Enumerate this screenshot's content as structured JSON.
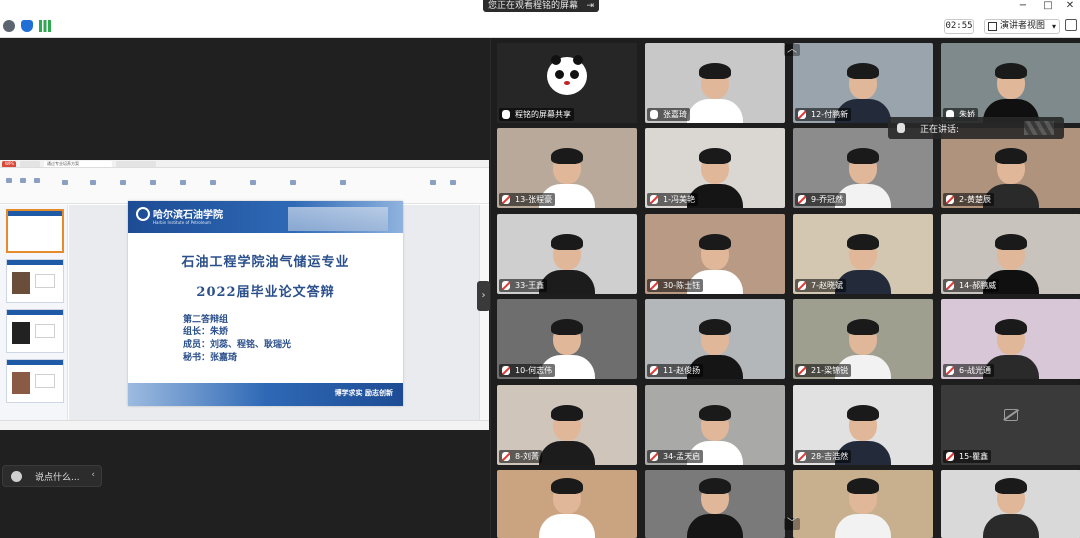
{
  "window": {
    "share_notice": "您正在观看程铭的屏幕",
    "share_notice_icon": "exit-icon",
    "controls": [
      "−",
      "□",
      "✕"
    ]
  },
  "toolbar": {
    "timer": "02:55",
    "view_label": "演讲者视图",
    "view_caret": "▾",
    "icons": [
      "info-icon",
      "shield-icon",
      "signal-icon"
    ]
  },
  "shared_screen": {
    "app_tabs": [
      "WPS",
      "",
      "通过专业培养方案",
      ""
    ],
    "slide": {
      "school_cn": "哈尔滨石油学院",
      "school_en": "Harbin Institute of Petroleum",
      "title_line1": "石油工程学院油气储运专业",
      "title_line2": "2022届毕业论文答辩",
      "group": "第二答辩组",
      "leader": "组长：朱娇",
      "members": "成员：刘蕊、程铭、耿瑞光",
      "secretary": "秘书：张嘉琦",
      "motto": "博学求实  励志创新"
    },
    "collapse_arrow": "›"
  },
  "chat": {
    "placeholder": "说点什么...",
    "collapse_arrow": "‹"
  },
  "speaking_indicator": {
    "label": "正在讲话:"
  },
  "grid_nav": {
    "up": "︿",
    "down": "﹀"
  },
  "participants": [
    {
      "label": "程铭的屏幕共享",
      "mic": "on",
      "kind": "panda"
    },
    {
      "label": "张嘉琦",
      "mic": "on",
      "kind": "video"
    },
    {
      "label": "12-付鹏新",
      "mic": "off",
      "kind": "video"
    },
    {
      "label": "朱娇",
      "mic": "on",
      "kind": "video"
    },
    {
      "label": "13-张程豪",
      "mic": "off",
      "kind": "video"
    },
    {
      "label": "1-冯美艳",
      "mic": "off",
      "kind": "video"
    },
    {
      "label": "9-乔冠然",
      "mic": "off",
      "kind": "video"
    },
    {
      "label": "2-黄楚辰",
      "mic": "off",
      "kind": "video"
    },
    {
      "label": "33-王鑫",
      "mic": "off",
      "kind": "video"
    },
    {
      "label": "30-陈士钰",
      "mic": "off",
      "kind": "video"
    },
    {
      "label": "7-赵晓斌",
      "mic": "off",
      "kind": "video"
    },
    {
      "label": "14-郝鹏威",
      "mic": "off",
      "kind": "video"
    },
    {
      "label": "10-何志伟",
      "mic": "off",
      "kind": "video"
    },
    {
      "label": "11-赵俊扬",
      "mic": "off",
      "kind": "video"
    },
    {
      "label": "21-梁锦锐",
      "mic": "off",
      "kind": "video"
    },
    {
      "label": "6-战光通",
      "mic": "off",
      "kind": "video"
    },
    {
      "label": "8-刘菁",
      "mic": "off",
      "kind": "video"
    },
    {
      "label": "34-孟天启",
      "mic": "off",
      "kind": "video"
    },
    {
      "label": "28-吉浩然",
      "mic": "off",
      "kind": "video"
    },
    {
      "label": "15-瞿鑫",
      "mic": "off",
      "kind": "camera-off"
    },
    {
      "label": "",
      "mic": "off",
      "kind": "video"
    },
    {
      "label": "",
      "mic": "off",
      "kind": "video"
    },
    {
      "label": "",
      "mic": "off",
      "kind": "video"
    },
    {
      "label": "",
      "mic": "off",
      "kind": "video"
    }
  ]
}
